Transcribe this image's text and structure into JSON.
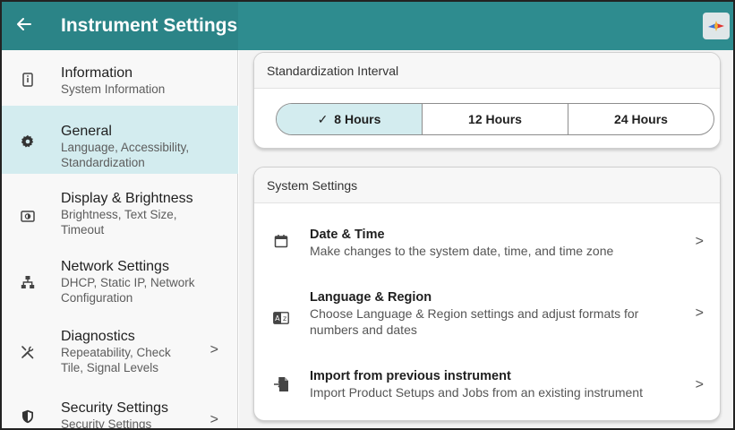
{
  "header": {
    "title": "Instrument Settings",
    "back_icon": "arrow-left-icon",
    "logo_icon": "brand-logo-icon"
  },
  "sidebar": {
    "items": [
      {
        "title": "Information",
        "subtitle": "System Information",
        "icon": "info-icon",
        "active": false
      },
      {
        "title": "General",
        "subtitle": "Language, Accessibility, Standardization",
        "icon": "gear-icon",
        "active": true
      },
      {
        "title": "Display & Brightness",
        "subtitle": "Brightness, Text Size, Timeout",
        "icon": "display-icon",
        "active": false
      },
      {
        "title": "Network Settings",
        "subtitle": "DHCP, Static IP, Network Configuration",
        "icon": "network-icon",
        "active": false
      },
      {
        "title": "Diagnostics",
        "subtitle": "Repeatability, Check Tile, Signal Levels",
        "icon": "tools-icon",
        "active": false,
        "chevron": ">"
      },
      {
        "title": "Security Settings",
        "subtitle": "Security Settings",
        "icon": "shield-icon",
        "active": false,
        "chevron": ">"
      }
    ]
  },
  "standardization": {
    "header": "Standardization Interval",
    "options": [
      {
        "label": "8 Hours",
        "selected": true,
        "check": "✓"
      },
      {
        "label": "12 Hours",
        "selected": false
      },
      {
        "label": "24 Hours",
        "selected": false
      }
    ]
  },
  "system_settings": {
    "header": "System Settings",
    "rows": [
      {
        "title": "Date & Time",
        "subtitle": "Make changes to the system date, time, and time zone",
        "icon": "calendar-icon",
        "chevron": ">"
      },
      {
        "title": "Language & Region",
        "subtitle": "Choose Language & Region settings and adjust formats for numbers and dates",
        "icon": "language-icon",
        "chevron": ">"
      },
      {
        "title": "Import from previous instrument",
        "subtitle": "Import Product Setups and Jobs from an existing instrument",
        "icon": "import-icon",
        "chevron": ">"
      }
    ]
  },
  "colors": {
    "appbar": "#2e8c8f",
    "active_item": "#d3ecef"
  }
}
